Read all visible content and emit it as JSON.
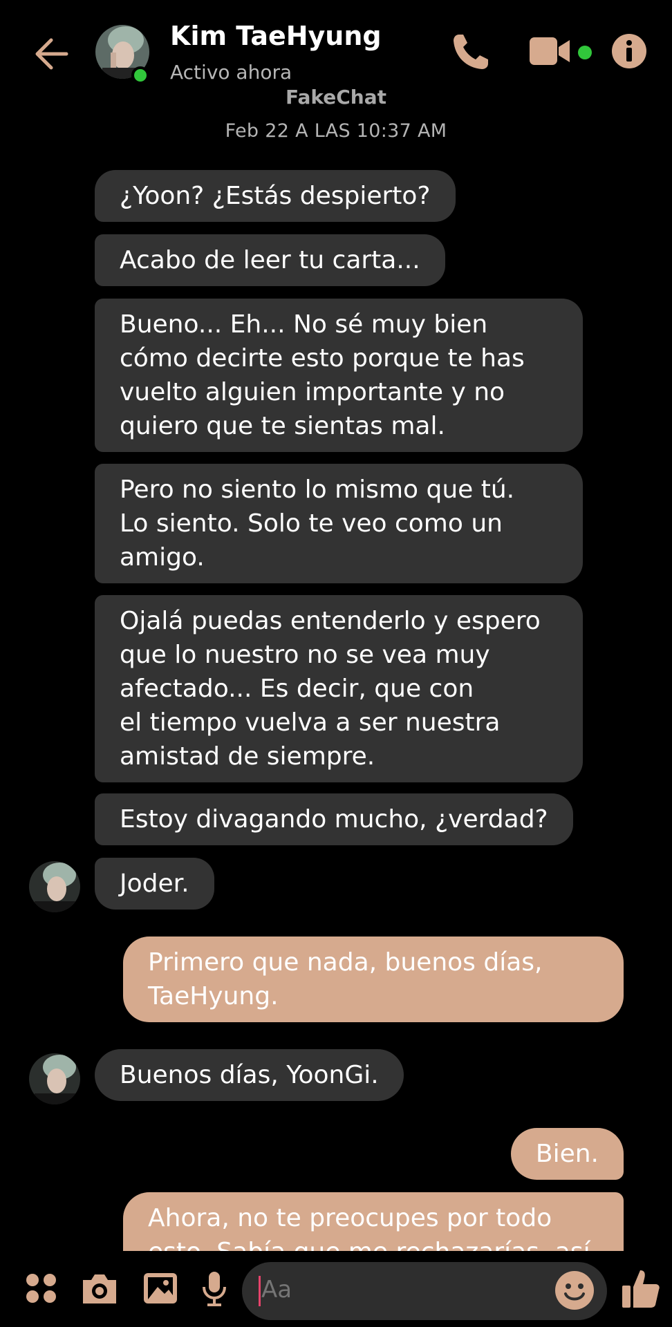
{
  "header": {
    "contact_name": "Kim TaeHyung",
    "status": "Activo ahora",
    "watermark": "FakeChat"
  },
  "timestamp": "Feb 22 A LAS 10:37 AM",
  "messages": [
    {
      "side": "in",
      "text": "¿Yoon? ¿Estás despierto?"
    },
    {
      "side": "in",
      "text": "Acabo de leer tu carta..."
    },
    {
      "side": "in",
      "text": "Bueno... Eh... No sé muy bien\ncómo decirte esto porque te has\nvuelto alguien importante y no\nquiero que te sientas mal."
    },
    {
      "side": "in",
      "text": "Pero no siento lo mismo que tú.\nLo siento. Solo te veo como un\namigo."
    },
    {
      "side": "in",
      "text": "Ojalá puedas entenderlo y espero\nque lo nuestro no se vea muy\nafectado... Es decir, que con\nel tiempo vuelva a ser nuestra\namistad de siempre."
    },
    {
      "side": "in",
      "text": "Estoy divagando mucho, ¿verdad?"
    },
    {
      "side": "in",
      "text": "Joder."
    },
    {
      "side": "out",
      "text": "Primero que nada, buenos días,\nTaeHyung."
    },
    {
      "side": "in",
      "text": "Buenos días, YoonGi."
    },
    {
      "side": "out",
      "text": "Bien."
    },
    {
      "side": "out",
      "text": "Ahora, no te preocupes por todo\nesto. Sabía que me rechazarías, así"
    }
  ],
  "composer": {
    "placeholder": "Aa"
  },
  "colors": {
    "accent": "#d6aa8e",
    "incoming_bubble": "#333333",
    "online": "#31c73b"
  },
  "icons": [
    "back-arrow-icon",
    "phone-icon",
    "video-camera-icon",
    "info-icon",
    "apps-icon",
    "camera-icon",
    "gallery-icon",
    "microphone-icon",
    "emoji-icon",
    "thumbs-up-icon"
  ]
}
